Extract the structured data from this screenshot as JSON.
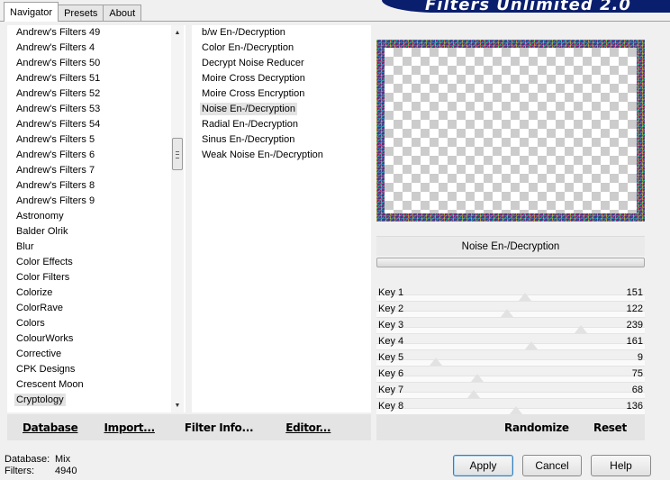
{
  "tabs": [
    {
      "label": "Navigator",
      "active": true
    },
    {
      "label": "Presets",
      "active": false
    },
    {
      "label": "About",
      "active": false
    }
  ],
  "banner_title": "Filters Unlimited 2.0",
  "categories": [
    "Andrew's Filters 49",
    "Andrew's Filters 4",
    "Andrew's Filters 50",
    "Andrew's Filters 51",
    "Andrew's Filters 52",
    "Andrew's Filters 53",
    "Andrew's Filters 54",
    "Andrew's Filters 5",
    "Andrew's Filters 6",
    "Andrew's Filters 7",
    "Andrew's Filters 8",
    "Andrew's Filters 9",
    "Astronomy",
    "Balder Olrik",
    "Blur",
    "Color Effects",
    "Color Filters",
    "Colorize",
    "ColorRave",
    "Colors",
    "ColourWorks",
    "Corrective",
    "CPK Designs",
    "Crescent Moon",
    "Cryptology"
  ],
  "selected_category": "Cryptology",
  "filters": [
    "b/w En-/Decryption",
    "Color En-/Decryption",
    "Decrypt Noise Reducer",
    "Moire Cross Decryption",
    "Moire Cross Encryption",
    "Noise En-/Decryption",
    "Radial En-/Decryption",
    "Sinus En-/Decryption",
    "Weak Noise En-/Decryption"
  ],
  "selected_filter": "Noise En-/Decryption",
  "preview_filter_name": "Noise En-/Decryption",
  "keys": [
    {
      "label": "Key 1",
      "value": "151",
      "level": 0.592
    },
    {
      "label": "Key 2",
      "value": "122",
      "level": 0.478
    },
    {
      "label": "Key 3",
      "value": "239",
      "level": 0.937
    },
    {
      "label": "Key 4",
      "value": "161",
      "level": 0.631
    },
    {
      "label": "Key 5",
      "value": "9",
      "level": 0.035
    },
    {
      "label": "Key 6",
      "value": "75",
      "level": 0.294
    },
    {
      "label": "Key 7",
      "value": "68",
      "level": 0.267
    },
    {
      "label": "Key 8",
      "value": "136",
      "level": 0.533
    }
  ],
  "bottom_left_buttons": [
    "Database",
    "Import...",
    "Filter Info...",
    "Editor..."
  ],
  "bottom_right_buttons": [
    "Randomize",
    "Reset"
  ],
  "status": {
    "database_label": "Database:",
    "database_value": "Mix",
    "filters_label": "Filters:",
    "filters_value": "4940"
  },
  "dialog_buttons": {
    "apply": "Apply",
    "cancel": "Cancel",
    "help": "Help"
  }
}
